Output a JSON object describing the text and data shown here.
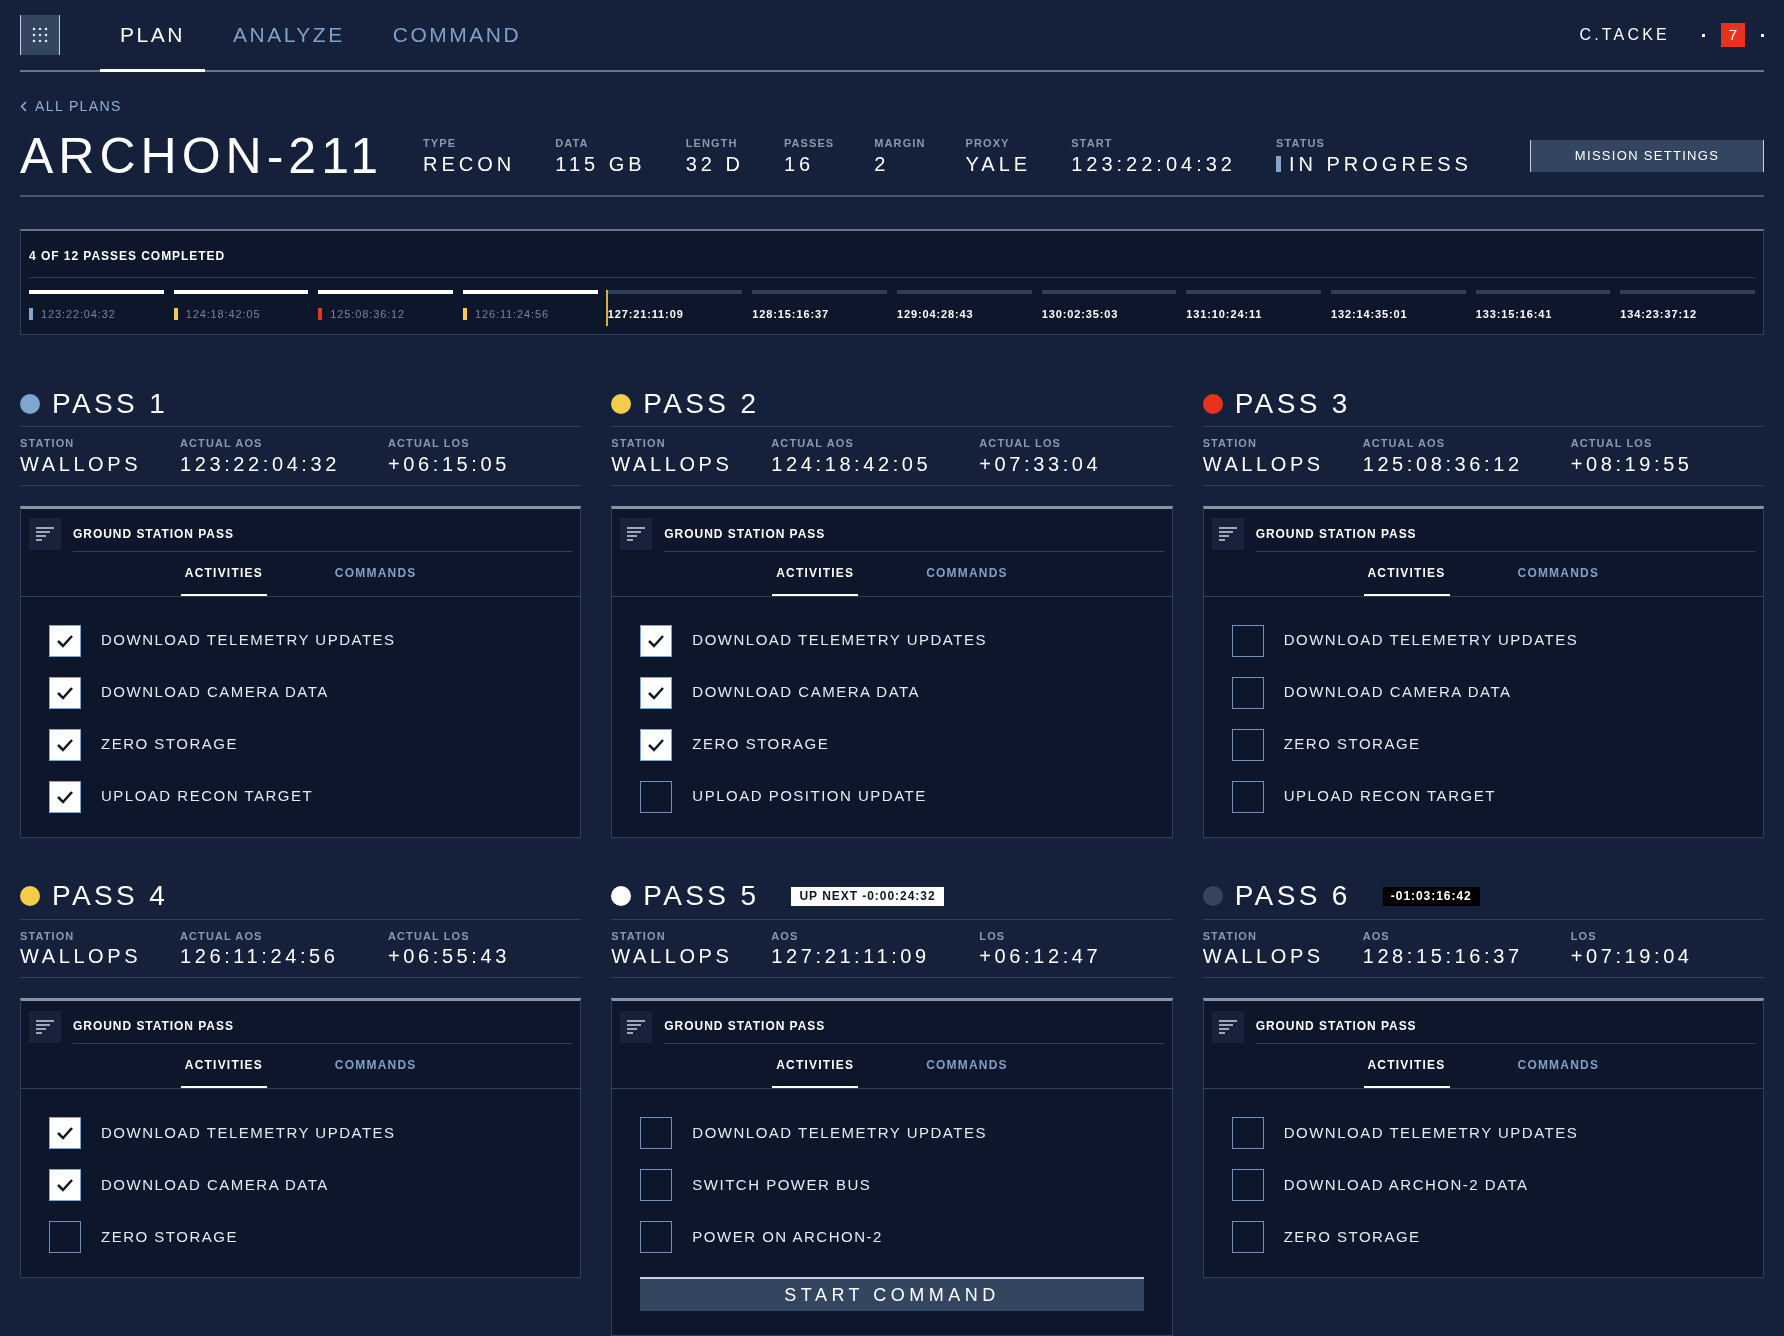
{
  "nav": {
    "tabs": [
      {
        "label": "PLAN",
        "selected": true
      },
      {
        "label": "ANALYZE",
        "selected": false
      },
      {
        "label": "COMMAND",
        "selected": false
      }
    ],
    "user": "C.TACKE",
    "notifications": "7"
  },
  "back_link": "ALL PLANS",
  "plan": {
    "title": "ARCHON-211",
    "fields": [
      {
        "label": "TYPE",
        "value": "RECON"
      },
      {
        "label": "DATA",
        "value": "115 GB"
      },
      {
        "label": "LENGTH",
        "value": "32 D"
      },
      {
        "label": "PASSES",
        "value": "16"
      },
      {
        "label": "MARGIN",
        "value": "2"
      },
      {
        "label": "PROXY",
        "value": "YALE"
      },
      {
        "label": "START",
        "value": "123:22:04:32"
      },
      {
        "label": "STATUS",
        "value": "IN PROGRESS",
        "kind": "status"
      }
    ],
    "settings_button": "MISSION SETTINGS"
  },
  "timeline": {
    "title": "4 OF 12 PASSES COMPLETED",
    "passes": [
      {
        "time": "123:22:04:32",
        "completed": true,
        "color": "#7fa6d0"
      },
      {
        "time": "124:18:42:05",
        "completed": true,
        "color": "#f2cd4a"
      },
      {
        "time": "125:08:36:12",
        "completed": true,
        "color": "#e8321e"
      },
      {
        "time": "126:11:24:56",
        "completed": true,
        "color": "#f2cd4a"
      },
      {
        "time": "127:21:11:09",
        "completed": false
      },
      {
        "time": "128:15:16:37",
        "completed": false
      },
      {
        "time": "129:04:28:43",
        "completed": false
      },
      {
        "time": "130:02:35:03",
        "completed": false
      },
      {
        "time": "131:10:24:11",
        "completed": false
      },
      {
        "time": "132:14:35:01",
        "completed": false
      },
      {
        "time": "133:15:16:41",
        "completed": false
      },
      {
        "time": "134:23:37:12",
        "completed": false
      }
    ]
  },
  "passes": [
    {
      "title": "PASS 1",
      "color": "#7fa6d0",
      "stats": [
        {
          "label": "STATION",
          "value": "WALLOPS"
        },
        {
          "label": "ACTUAL AOS",
          "value": "123:22:04:32"
        },
        {
          "label": "ACTUAL LOS",
          "value": "+06:15:05"
        }
      ],
      "panel_title": "GROUND STATION PASS",
      "tabs": [
        {
          "label": "ACTIVITIES",
          "selected": true
        },
        {
          "label": "COMMANDS",
          "selected": false
        }
      ],
      "activities": [
        {
          "label": "DOWNLOAD TELEMETRY UPDATES",
          "checked": true
        },
        {
          "label": "DOWNLOAD CAMERA DATA",
          "checked": true
        },
        {
          "label": "ZERO STORAGE",
          "checked": true
        },
        {
          "label": "UPLOAD RECON TARGET",
          "checked": true
        }
      ]
    },
    {
      "title": "PASS 2",
      "color": "#f2cd4a",
      "stats": [
        {
          "label": "STATION",
          "value": "WALLOPS"
        },
        {
          "label": "ACTUAL AOS",
          "value": "124:18:42:05"
        },
        {
          "label": "ACTUAL LOS",
          "value": "+07:33:04"
        }
      ],
      "panel_title": "GROUND STATION PASS",
      "tabs": [
        {
          "label": "ACTIVITIES",
          "selected": true
        },
        {
          "label": "COMMANDS",
          "selected": false
        }
      ],
      "activities": [
        {
          "label": "DOWNLOAD TELEMETRY UPDATES",
          "checked": true
        },
        {
          "label": "DOWNLOAD CAMERA DATA",
          "checked": true
        },
        {
          "label": "ZERO STORAGE",
          "checked": true
        },
        {
          "label": "UPLOAD POSITION UPDATE",
          "checked": false
        }
      ]
    },
    {
      "title": "PASS 3",
      "color": "#e8321e",
      "stats": [
        {
          "label": "STATION",
          "value": "WALLOPS"
        },
        {
          "label": "ACTUAL AOS",
          "value": "125:08:36:12"
        },
        {
          "label": "ACTUAL LOS",
          "value": "+08:19:55"
        }
      ],
      "panel_title": "GROUND STATION PASS",
      "tabs": [
        {
          "label": "ACTIVITIES",
          "selected": true
        },
        {
          "label": "COMMANDS",
          "selected": false
        }
      ],
      "activities": [
        {
          "label": "DOWNLOAD TELEMETRY UPDATES",
          "checked": false
        },
        {
          "label": "DOWNLOAD CAMERA DATA",
          "checked": false
        },
        {
          "label": "ZERO STORAGE",
          "checked": false
        },
        {
          "label": "UPLOAD RECON TARGET",
          "checked": false
        }
      ]
    },
    {
      "title": "PASS 4",
      "color": "#f2cd4a",
      "stats": [
        {
          "label": "STATION",
          "value": "WALLOPS"
        },
        {
          "label": "ACTUAL AOS",
          "value": "126:11:24:56"
        },
        {
          "label": "ACTUAL LOS",
          "value": "+06:55:43"
        }
      ],
      "panel_title": "GROUND STATION PASS",
      "tabs": [
        {
          "label": "ACTIVITIES",
          "selected": true
        },
        {
          "label": "COMMANDS",
          "selected": false
        }
      ],
      "activities": [
        {
          "label": "DOWNLOAD TELEMETRY UPDATES",
          "checked": true
        },
        {
          "label": "DOWNLOAD CAMERA DATA",
          "checked": true
        },
        {
          "label": "ZERO STORAGE",
          "checked": false
        }
      ]
    },
    {
      "title": "PASS 5",
      "color": "#ffffff",
      "badge": {
        "text": "UP NEXT -0:00:24:32",
        "kind": "light"
      },
      "stats": [
        {
          "label": "STATION",
          "value": "WALLOPS"
        },
        {
          "label": "AOS",
          "value": "127:21:11:09"
        },
        {
          "label": "LOS",
          "value": "+06:12:47"
        }
      ],
      "panel_title": "GROUND STATION PASS",
      "tabs": [
        {
          "label": "ACTIVITIES",
          "selected": true
        },
        {
          "label": "COMMANDS",
          "selected": false
        }
      ],
      "activities": [
        {
          "label": "DOWNLOAD TELEMETRY UPDATES",
          "checked": false
        },
        {
          "label": "SWITCH POWER BUS",
          "checked": false
        },
        {
          "label": "POWER ON ARCHON-2",
          "checked": false
        }
      ],
      "action_button": "START COMMAND"
    },
    {
      "title": "PASS 6",
      "color": "#34445f",
      "badge": {
        "text": "-01:03:16:42",
        "kind": "dark"
      },
      "stats": [
        {
          "label": "STATION",
          "value": "WALLOPS"
        },
        {
          "label": "AOS",
          "value": "128:15:16:37"
        },
        {
          "label": "LOS",
          "value": "+07:19:04"
        }
      ],
      "panel_title": "GROUND STATION PASS",
      "tabs": [
        {
          "label": "ACTIVITIES",
          "selected": true
        },
        {
          "label": "COMMANDS",
          "selected": false
        }
      ],
      "activities": [
        {
          "label": "DOWNLOAD TELEMETRY UPDATES",
          "checked": false
        },
        {
          "label": "DOWNLOAD ARCHON-2 DATA",
          "checked": false
        },
        {
          "label": "ZERO STORAGE",
          "checked": false
        }
      ]
    }
  ]
}
